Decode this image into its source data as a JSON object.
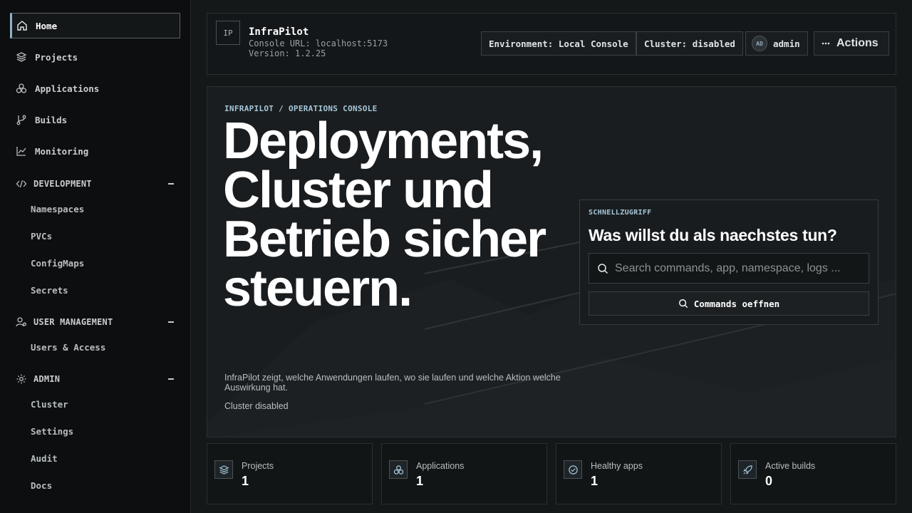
{
  "sidebar": {
    "items": [
      {
        "label": "Home",
        "icon": "home-icon",
        "active": true
      },
      {
        "label": "Projects",
        "icon": "layers-icon"
      },
      {
        "label": "Applications",
        "icon": "apps-icon"
      },
      {
        "label": "Builds",
        "icon": "git-branch-icon"
      },
      {
        "label": "Monitoring",
        "icon": "chart-line-icon"
      }
    ],
    "sections": [
      {
        "label": "DEVELOPMENT",
        "icon": "code-icon",
        "children": [
          "Namespaces",
          "PVCs",
          "ConfigMaps",
          "Secrets"
        ]
      },
      {
        "label": "USER MANAGEMENT",
        "icon": "user-gear-icon",
        "children": [
          "Users & Access"
        ]
      },
      {
        "label": "ADMIN",
        "icon": "gear-icon",
        "children": [
          "Cluster",
          "Settings",
          "Audit",
          "Docs"
        ]
      }
    ]
  },
  "header": {
    "logo": "IP",
    "app_name": "InfraPilot",
    "console_url": "Console URL: localhost:5173",
    "version": "Version: 1.2.25",
    "environment": "Environment: Local Console",
    "cluster": "Cluster: disabled",
    "user_initials": "AD",
    "user_name": "admin",
    "actions_label": "Actions"
  },
  "hero": {
    "breadcrumb": "INFRAPILOT / OPERATIONS CONSOLE",
    "headline": "Deployments, Cluster und Betrieb sicher steuern.",
    "description": "InfraPilot zeigt, welche Anwendungen laufen, wo sie laufen und welche Aktion welche Auswirkung hat.",
    "status": "Cluster disabled"
  },
  "quick_access": {
    "kicker": "SCHNELLZUGRIFF",
    "title": "Was willst du als naechstes tun?",
    "search_placeholder": "Search commands, app, namespace, logs ...",
    "button_label": "Commands oeffnen"
  },
  "stats": [
    {
      "label": "Projects",
      "value": "1",
      "icon": "layers-icon"
    },
    {
      "label": "Applications",
      "value": "1",
      "icon": "apps-icon"
    },
    {
      "label": "Healthy apps",
      "value": "1",
      "icon": "check-circle-icon"
    },
    {
      "label": "Active builds",
      "value": "0",
      "icon": "rocket-icon"
    }
  ],
  "colors": {
    "accent": "#a6c7da",
    "background": "#151819",
    "sidebar": "#0c0e0f"
  }
}
